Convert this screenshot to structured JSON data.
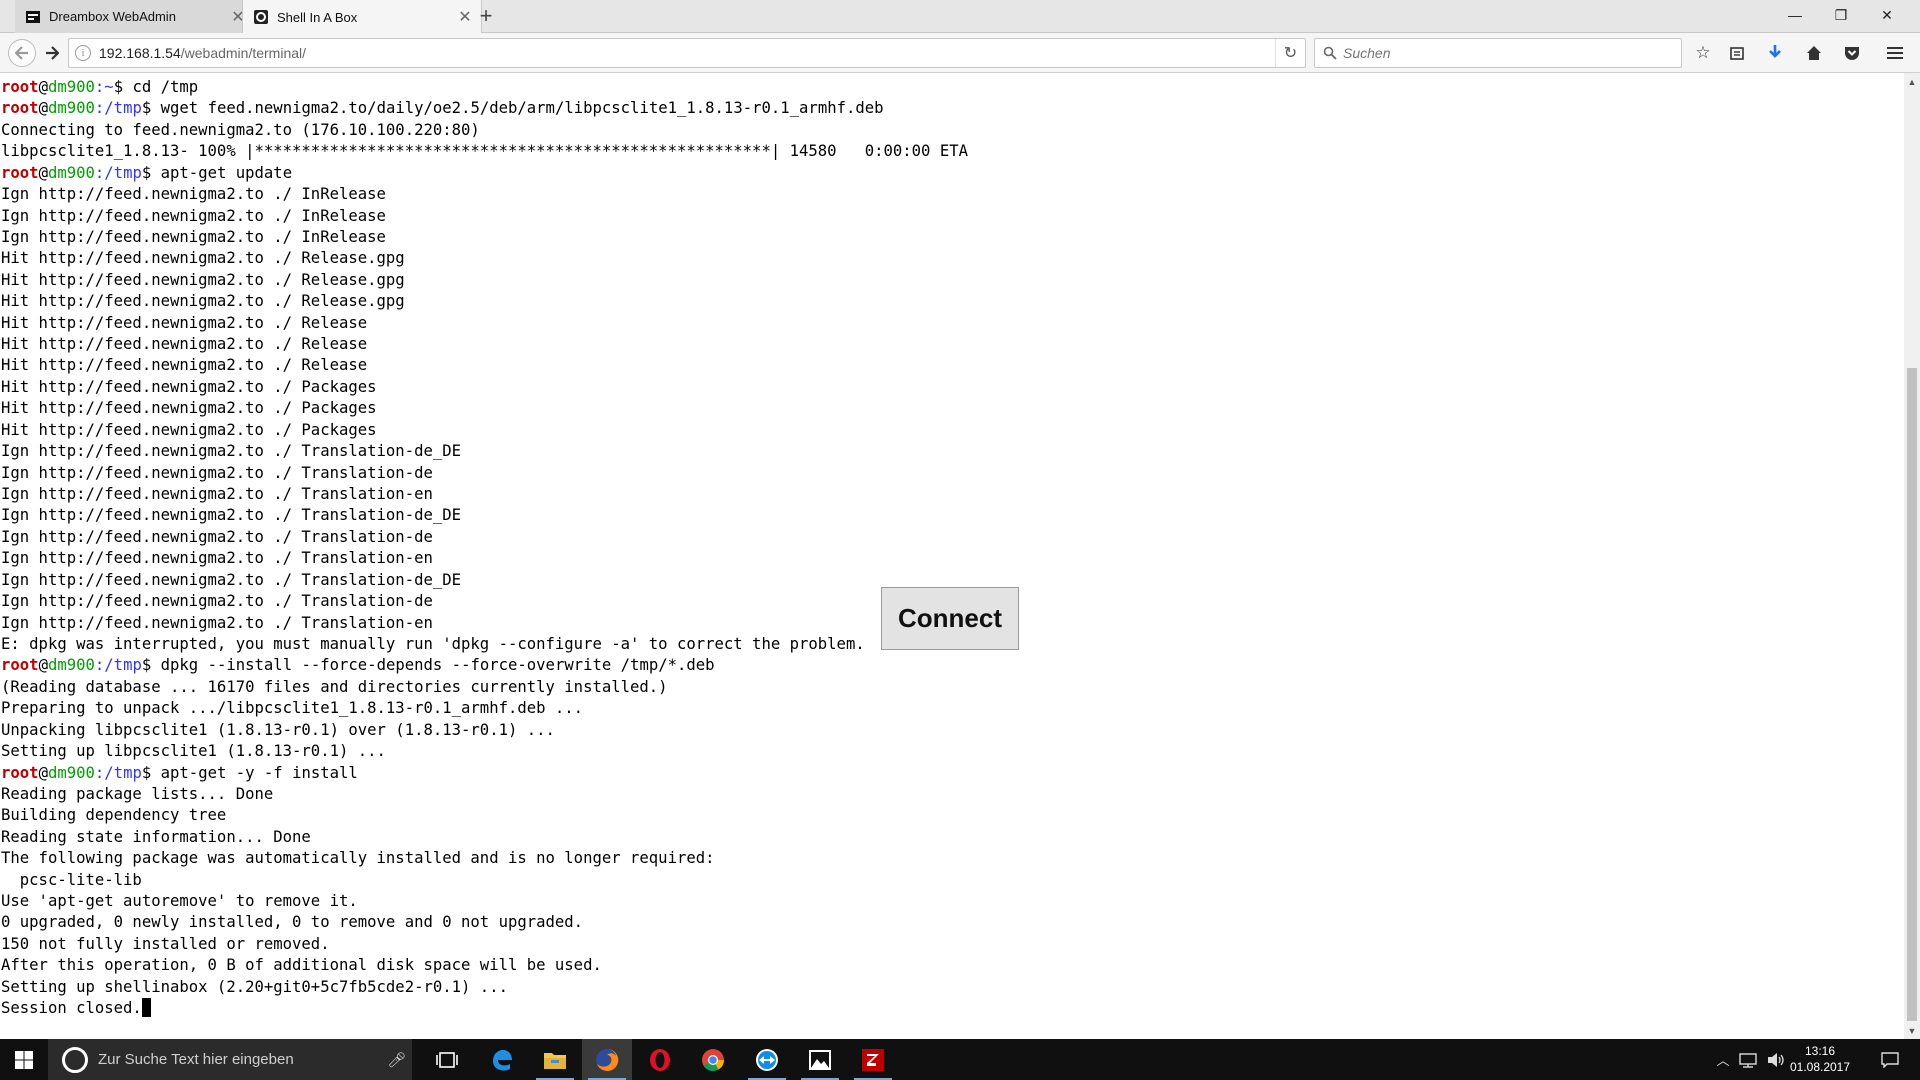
{
  "tabs": [
    {
      "title": "Dreambox WebAdmin",
      "favicon": "dreambox-icon"
    },
    {
      "title": "Shell In A Box",
      "favicon": "shellinabox-icon"
    }
  ],
  "navbar": {
    "url_host": "192.168.1.54",
    "url_path": "/webadmin/terminal/",
    "search_placeholder": "Suchen"
  },
  "terminal": {
    "prompt": {
      "user": "root",
      "at": "@",
      "host": "dm900",
      "sep": ":"
    },
    "lines": [
      {
        "type": "cmd",
        "path": "~",
        "command": "cd /tmp"
      },
      {
        "type": "cmd",
        "path": "/tmp",
        "command": "wget feed.newnigma2.to/daily/oe2.5/deb/arm/libpcsclite1_1.8.13-r0.1_armhf.deb"
      },
      {
        "type": "out",
        "text": "Connecting to feed.newnigma2.to (176.10.100.220:80)"
      },
      {
        "type": "out",
        "text": "libpcsclite1_1.8.13- 100% |*******************************************************| 14580   0:00:00 ETA"
      },
      {
        "type": "cmd",
        "path": "/tmp",
        "command": "apt-get update"
      },
      {
        "type": "out",
        "text": "Ign http://feed.newnigma2.to ./ InRelease"
      },
      {
        "type": "out",
        "text": "Ign http://feed.newnigma2.to ./ InRelease"
      },
      {
        "type": "out",
        "text": "Ign http://feed.newnigma2.to ./ InRelease"
      },
      {
        "type": "out",
        "text": "Hit http://feed.newnigma2.to ./ Release.gpg"
      },
      {
        "type": "out",
        "text": "Hit http://feed.newnigma2.to ./ Release.gpg"
      },
      {
        "type": "out",
        "text": "Hit http://feed.newnigma2.to ./ Release.gpg"
      },
      {
        "type": "out",
        "text": "Hit http://feed.newnigma2.to ./ Release"
      },
      {
        "type": "out",
        "text": "Hit http://feed.newnigma2.to ./ Release"
      },
      {
        "type": "out",
        "text": "Hit http://feed.newnigma2.to ./ Release"
      },
      {
        "type": "out",
        "text": "Hit http://feed.newnigma2.to ./ Packages"
      },
      {
        "type": "out",
        "text": "Hit http://feed.newnigma2.to ./ Packages"
      },
      {
        "type": "out",
        "text": "Hit http://feed.newnigma2.to ./ Packages"
      },
      {
        "type": "out",
        "text": "Ign http://feed.newnigma2.to ./ Translation-de_DE"
      },
      {
        "type": "out",
        "text": "Ign http://feed.newnigma2.to ./ Translation-de"
      },
      {
        "type": "out",
        "text": "Ign http://feed.newnigma2.to ./ Translation-en"
      },
      {
        "type": "out",
        "text": "Ign http://feed.newnigma2.to ./ Translation-de_DE"
      },
      {
        "type": "out",
        "text": "Ign http://feed.newnigma2.to ./ Translation-de"
      },
      {
        "type": "out",
        "text": "Ign http://feed.newnigma2.to ./ Translation-en"
      },
      {
        "type": "out",
        "text": "Ign http://feed.newnigma2.to ./ Translation-de_DE"
      },
      {
        "type": "out",
        "text": "Ign http://feed.newnigma2.to ./ Translation-de"
      },
      {
        "type": "out",
        "text": "Ign http://feed.newnigma2.to ./ Translation-en"
      },
      {
        "type": "out",
        "text": "E: dpkg was interrupted, you must manually run 'dpkg --configure -a' to correct the problem."
      },
      {
        "type": "cmd",
        "path": "/tmp",
        "command": "dpkg --install --force-depends --force-overwrite /tmp/*.deb"
      },
      {
        "type": "out",
        "text": "(Reading database ... 16170 files and directories currently installed.)"
      },
      {
        "type": "out",
        "text": "Preparing to unpack .../libpcsclite1_1.8.13-r0.1_armhf.deb ..."
      },
      {
        "type": "out",
        "text": "Unpacking libpcsclite1 (1.8.13-r0.1) over (1.8.13-r0.1) ..."
      },
      {
        "type": "out",
        "text": "Setting up libpcsclite1 (1.8.13-r0.1) ..."
      },
      {
        "type": "cmd",
        "path": "/tmp",
        "command": "apt-get -y -f install"
      },
      {
        "type": "out",
        "text": "Reading package lists... Done"
      },
      {
        "type": "out",
        "text": "Building dependency tree"
      },
      {
        "type": "out",
        "text": "Reading state information... Done"
      },
      {
        "type": "out",
        "text": "The following package was automatically installed and is no longer required:"
      },
      {
        "type": "out",
        "text": "  pcsc-lite-lib"
      },
      {
        "type": "out",
        "text": "Use 'apt-get autoremove' to remove it."
      },
      {
        "type": "out",
        "text": "0 upgraded, 0 newly installed, 0 to remove and 0 not upgraded."
      },
      {
        "type": "out",
        "text": "150 not fully installed or removed."
      },
      {
        "type": "out",
        "text": "After this operation, 0 B of additional disk space will be used."
      },
      {
        "type": "out",
        "text": "Setting up shellinabox (2.20+git0+5c7fb5cde2-r0.1) ..."
      },
      {
        "type": "last",
        "text": "Session closed."
      }
    ],
    "connect_label": "Connect"
  },
  "taskbar": {
    "search_placeholder": "Zur Suche Text hier eingeben",
    "apps": [
      "task-view-icon",
      "edge-icon",
      "file-explorer-icon",
      "firefox-icon",
      "opera-icon",
      "chrome-icon",
      "teamviewer-icon",
      "photos-icon",
      "filezilla-icon"
    ],
    "time": "13:16",
    "date": "01.08.2017"
  },
  "colors": {
    "prompt_user": "#c00000",
    "prompt_host": "#00a000",
    "prompt_path": "#3333ff",
    "taskbar_bg": "#101010"
  }
}
